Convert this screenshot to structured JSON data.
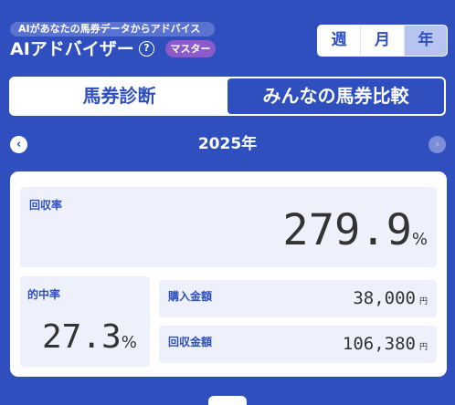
{
  "header": {
    "tagline": "AIがあなたの馬券データからアドバイス",
    "title": "AIアドバイザー",
    "help_symbol": "?",
    "badge": "マスター"
  },
  "period_tabs": [
    {
      "label": "週",
      "active": false
    },
    {
      "label": "月",
      "active": false
    },
    {
      "label": "年",
      "active": true
    }
  ],
  "main_tabs": {
    "diagnosis": "馬券診断",
    "compare": "みんなの馬券比較"
  },
  "year_nav": {
    "year": "2025年",
    "prev_symbol": "‹",
    "next_symbol": "›"
  },
  "stats": {
    "recovery_rate": {
      "label": "回収率",
      "value": "279.9",
      "unit": "%"
    },
    "hit_rate": {
      "label": "的中率",
      "value": "27.3",
      "unit": "%"
    },
    "purchase_amount": {
      "label": "購入金額",
      "value": "38,000",
      "unit": "円"
    },
    "return_amount": {
      "label": "回収金額",
      "value": "106,380",
      "unit": "円"
    }
  },
  "colors": {
    "brand": "#2f4fbe",
    "panel": "#eef1fc",
    "badge": "#8a5bc9",
    "active_period": "#b7c4ef"
  }
}
